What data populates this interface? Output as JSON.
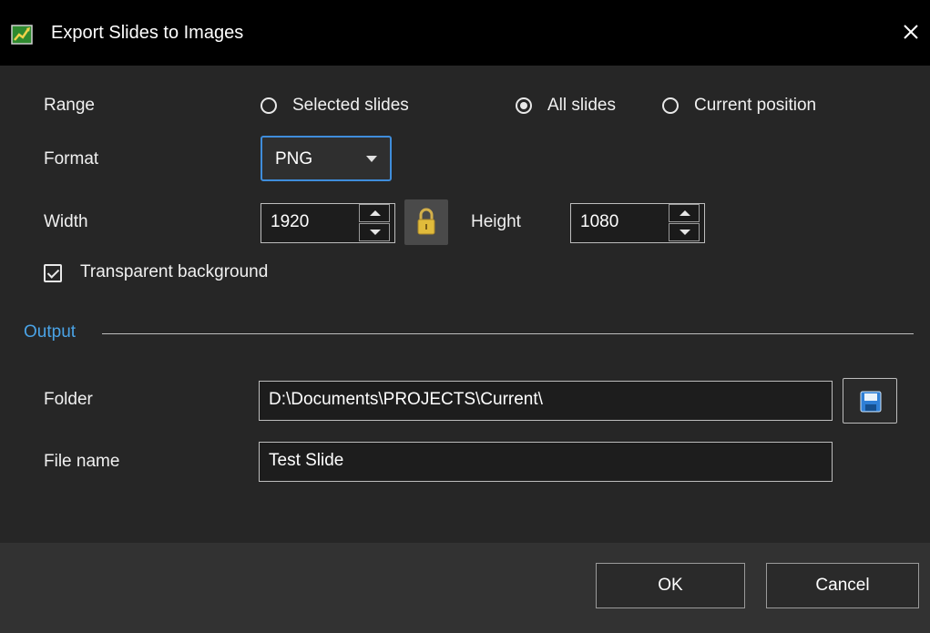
{
  "window": {
    "title": "Export Slides to Images",
    "app_icon": "slideshow-chart-icon",
    "close_icon": "close-icon"
  },
  "range": {
    "label": "Range",
    "options": [
      {
        "label": "Selected slides",
        "checked": false
      },
      {
        "label": "All slides",
        "checked": true
      },
      {
        "label": "Current position",
        "checked": false
      }
    ]
  },
  "format": {
    "label": "Format",
    "value": "PNG"
  },
  "size": {
    "width_label": "Width",
    "width_value": "1920",
    "height_label": "Height",
    "height_value": "1080",
    "lock_icon": "lock-icon"
  },
  "transparent": {
    "label": "Transparent background",
    "checked": true
  },
  "output": {
    "group_label": "Output",
    "folder_label": "Folder",
    "folder_value": "D:\\Documents\\PROJECTS\\Current\\",
    "save_icon": "save-folder-icon",
    "filename_label": "File name",
    "filename_value": "Test Slide"
  },
  "buttons": {
    "ok": "OK",
    "cancel": "Cancel"
  },
  "colors": {
    "accent": "#3f8ddb",
    "group_label": "#4aa3e6",
    "background": "#262626",
    "titlebar": "#000000"
  }
}
